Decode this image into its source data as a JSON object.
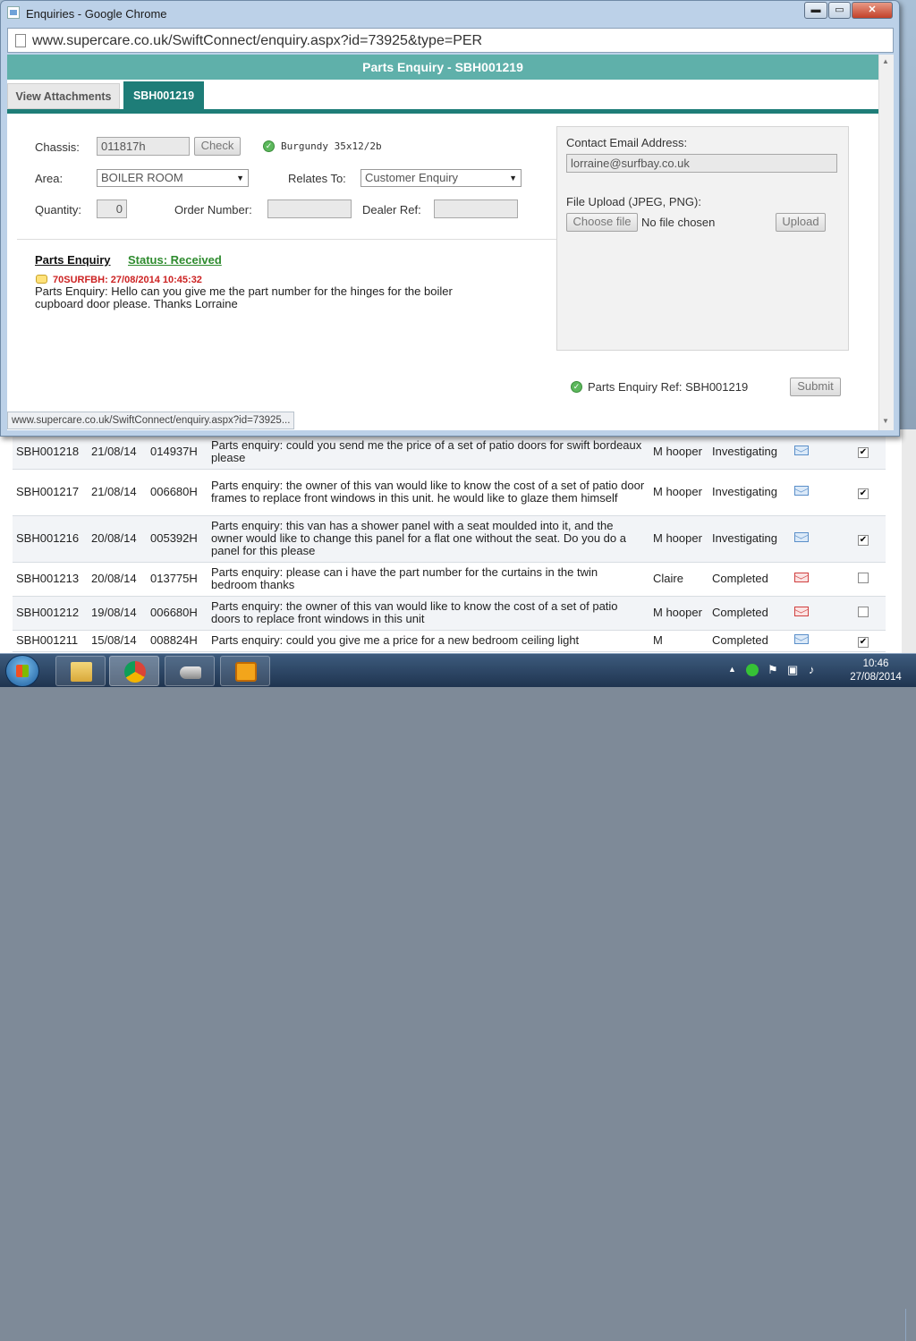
{
  "browser": {
    "window_title": "Enquiries - Google Chrome",
    "min_label": "▬",
    "max_label": "▭",
    "close_label": "✕",
    "url": "www.supercare.co.uk/SwiftConnect/enquiry.aspx?id=73925&type=PER",
    "status_url": "www.supercare.co.uk/SwiftConnect/enquiry.aspx?id=73925..."
  },
  "page": {
    "header": "Parts Enquiry - SBH001219",
    "tabs": [
      {
        "label": "View Attachments",
        "active": false
      },
      {
        "label": "SBH001219",
        "active": true
      }
    ],
    "form": {
      "chassis_label": "Chassis:",
      "chassis_value": "011817h",
      "check_button": "Check",
      "model_text": "Burgundy 35x12/2b",
      "area_label": "Area:",
      "area_value": "BOILER ROOM",
      "relates_label": "Relates To:",
      "relates_value": "Customer Enquiry",
      "quantity_label": "Quantity:",
      "quantity_value": "0",
      "order_number_label": "Order Number:",
      "order_number_value": "",
      "dealer_ref_label": "Dealer Ref:",
      "dealer_ref_value": ""
    },
    "enquiry": {
      "title": "Parts Enquiry",
      "status": "Status: Received",
      "author_time": "70SURFBH: 27/08/2014 10:45:32",
      "message": "Parts Enquiry: Hello can you give me the part number for the hinges for the boiler cupboard door please. Thanks Lorraine"
    },
    "contact": {
      "email_label": "Contact Email Address:",
      "email_value": "lorraine@surfbay.co.uk",
      "upload_label": "File Upload (JPEG, PNG):",
      "choose_file": "Choose file",
      "no_file": "No file chosen",
      "upload_button": "Upload"
    },
    "footer": {
      "ref_text": "Parts Enquiry Ref: SBH001219",
      "submit_button": "Submit"
    }
  },
  "background_list": {
    "rows": [
      {
        "ref": "SBH001218",
        "date": "21/08/14",
        "chassis": "014937H",
        "desc": "Parts enquiry: could you send me the price of a set of patio doors for swift bordeaux please",
        "user": "M hooper",
        "status": "Investigating",
        "mail": "blue",
        "checked": true
      },
      {
        "ref": "SBH001217",
        "date": "21/08/14",
        "chassis": "006680H",
        "desc": "Parts enquiry: the owner of this van would like to know the cost of a set of patio door frames to replace front windows in this unit. he would like to glaze them himself",
        "user": "M hooper",
        "status": "Investigating",
        "mail": "blue",
        "checked": true
      },
      {
        "ref": "SBH001216",
        "date": "20/08/14",
        "chassis": "005392H",
        "desc": "Parts enquiry: this van has a shower panel with a seat moulded into it, and the owner would like to change this panel for a flat one without the seat. Do you do a panel for this please",
        "user": "M hooper",
        "status": "Investigating",
        "mail": "blue",
        "checked": true
      },
      {
        "ref": "SBH001213",
        "date": "20/08/14",
        "chassis": "013775H",
        "desc": "Parts enquiry: please can i have the part number for the curtains in the twin bedroom thanks",
        "user": "Claire",
        "status": "Completed",
        "mail": "red",
        "checked": false
      },
      {
        "ref": "SBH001212",
        "date": "19/08/14",
        "chassis": "006680H",
        "desc": "Parts enquiry: the owner of this van would like to know the cost of a set of patio doors to replace front windows in this unit",
        "user": "M hooper",
        "status": "Completed",
        "mail": "red",
        "checked": false
      },
      {
        "ref": "SBH001211",
        "date": "15/08/14",
        "chassis": "008824H",
        "desc": "Parts enquiry: could you give me a price for a new bedroom ceiling light",
        "user": "M",
        "status": "Completed",
        "mail": "blue",
        "checked": true
      }
    ]
  },
  "taskbar": {
    "time": "10:46",
    "date": "27/08/2014",
    "apps": [
      "windows-explorer",
      "google-chrome",
      "whistle-app",
      "outlook"
    ]
  },
  "colors": {
    "header_teal": "#5fb0aa",
    "tab_active": "#1e7d78",
    "status_green": "#2e8b2e",
    "author_red": "#cc2222"
  }
}
